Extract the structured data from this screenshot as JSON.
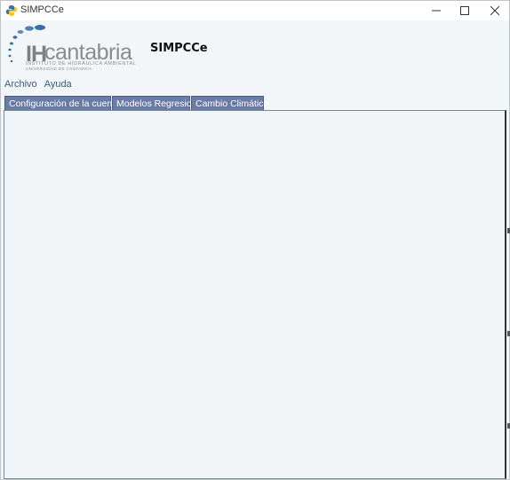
{
  "window": {
    "title": "SIMPCCe",
    "minimize_icon": "minimize-icon",
    "maximize_icon": "maximize-icon",
    "close_icon": "close-icon"
  },
  "header": {
    "logo": {
      "brand_ih": "IH",
      "brand_name": "cantabria",
      "subtitle": "INSTITUTO DE HIDRÁULICA AMBIENTAL",
      "subtitle2": "UNIVERSIDAD DE CANTABRIA"
    },
    "app_title": "SIMPCCe"
  },
  "menubar": {
    "items": [
      "Archivo",
      "Ayuda"
    ]
  },
  "tabs": [
    {
      "label": "Configuración de la cuenca"
    },
    {
      "label": "Modelos Regresion"
    },
    {
      "label": "Cambio Climático"
    }
  ],
  "colors": {
    "tab_bg": "#6a7ba6",
    "background": "#f2f6f8",
    "menu_text": "#3a5a7a"
  }
}
